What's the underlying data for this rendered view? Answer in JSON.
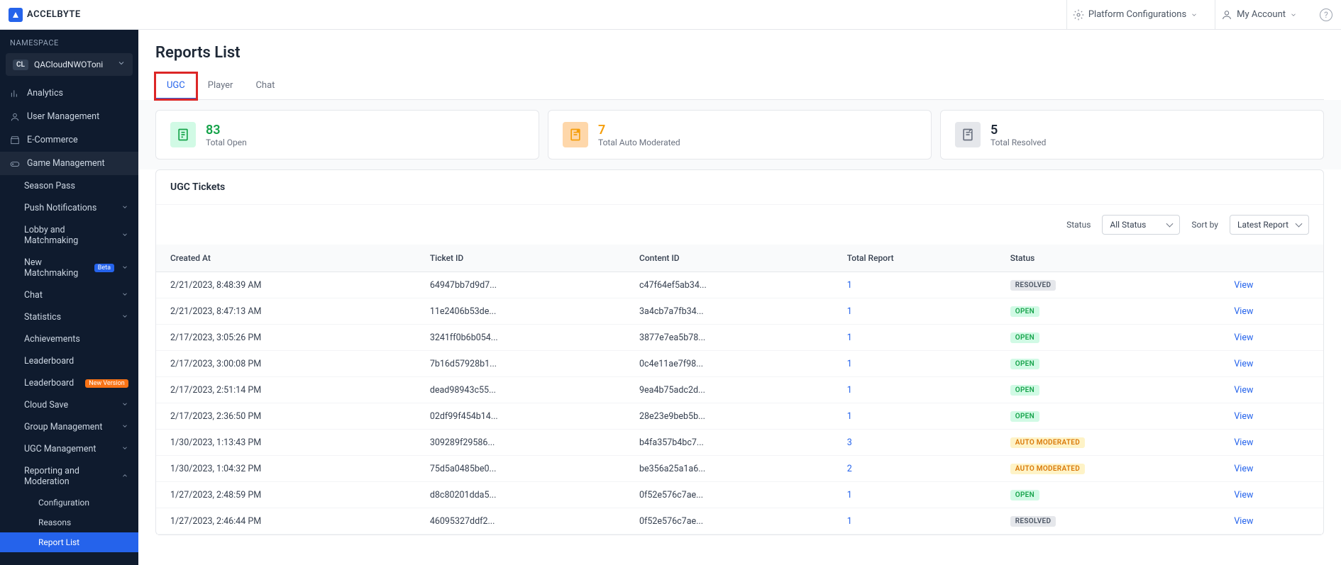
{
  "brand": "ACCELBYTE",
  "topbar": {
    "platform_config": "Platform Configurations",
    "my_account": "My Account"
  },
  "sidebar": {
    "namespace_header": "NAMESPACE",
    "namespace_badge": "CL",
    "namespace_name": "QACloudNWOToni",
    "items": {
      "analytics": "Analytics",
      "user_management": "User Management",
      "ecommerce": "E-Commerce",
      "game_management": "Game Management"
    },
    "game_sub": {
      "season_pass": "Season Pass",
      "push_notifications": "Push Notifications",
      "lobby_matchmaking": "Lobby and Matchmaking",
      "new_matchmaking": "New Matchmaking",
      "beta": "Beta",
      "chat": "Chat",
      "statistics": "Statistics",
      "achievements": "Achievements",
      "leaderboard": "Leaderboard",
      "leaderboard_new": "Leaderboard",
      "new_version": "New Version",
      "cloud_save": "Cloud Save",
      "group_management": "Group Management",
      "ugc_management": "UGC Management",
      "reporting_moderation": "Reporting and Moderation"
    },
    "reporting_sub": {
      "configuration": "Configuration",
      "reasons": "Reasons",
      "report_list": "Report List"
    }
  },
  "page": {
    "title": "Reports List",
    "tabs": {
      "ugc": "UGC",
      "player": "Player",
      "chat": "Chat"
    }
  },
  "stats": {
    "open_value": "83",
    "open_label": "Total Open",
    "auto_value": "7",
    "auto_label": "Total Auto Moderated",
    "resolved_value": "5",
    "resolved_label": "Total Resolved"
  },
  "tickets": {
    "title": "UGC Tickets",
    "status_label": "Status",
    "status_value": "All Status",
    "sort_label": "Sort by",
    "sort_value": "Latest Report",
    "columns": {
      "created": "Created At",
      "ticket": "Ticket ID",
      "content": "Content ID",
      "total": "Total Report",
      "status": "Status"
    },
    "view_label": "View",
    "status_text": {
      "resolved": "RESOLVED",
      "open": "OPEN",
      "auto": "AUTO MODERATED"
    },
    "rows": [
      {
        "created": "2/21/2023, 8:48:39 AM",
        "ticket": "64947bb7d9d7...",
        "content": "c47f64ef5ab34...",
        "total": "1",
        "status": "resolved"
      },
      {
        "created": "2/21/2023, 8:47:13 AM",
        "ticket": "11e2406b53de...",
        "content": "3a4cb7a7fb34...",
        "total": "1",
        "status": "open"
      },
      {
        "created": "2/17/2023, 3:05:26 PM",
        "ticket": "3241ff0b6b054...",
        "content": "3877e7ea5b78...",
        "total": "1",
        "status": "open"
      },
      {
        "created": "2/17/2023, 3:00:08 PM",
        "ticket": "7b16d57928b1...",
        "content": "0c4e11ae7f98...",
        "total": "1",
        "status": "open"
      },
      {
        "created": "2/17/2023, 2:51:14 PM",
        "ticket": "dead98943c55...",
        "content": "9ea4b75adc2d...",
        "total": "1",
        "status": "open"
      },
      {
        "created": "2/17/2023, 2:36:50 PM",
        "ticket": "02df99f454b14...",
        "content": "28e23e9beb5b...",
        "total": "1",
        "status": "open"
      },
      {
        "created": "1/30/2023, 1:13:43 PM",
        "ticket": "309289f29586...",
        "content": "b4fa357b4bc7...",
        "total": "3",
        "status": "auto"
      },
      {
        "created": "1/30/2023, 1:04:32 PM",
        "ticket": "75d5a0485be0...",
        "content": "be356a25a1a6...",
        "total": "2",
        "status": "auto"
      },
      {
        "created": "1/27/2023, 2:48:59 PM",
        "ticket": "d8c80201dda5...",
        "content": "0f52e576c7ae...",
        "total": "1",
        "status": "open"
      },
      {
        "created": "1/27/2023, 2:46:44 PM",
        "ticket": "46095327ddf2...",
        "content": "0f52e576c7ae...",
        "total": "1",
        "status": "resolved"
      }
    ]
  }
}
